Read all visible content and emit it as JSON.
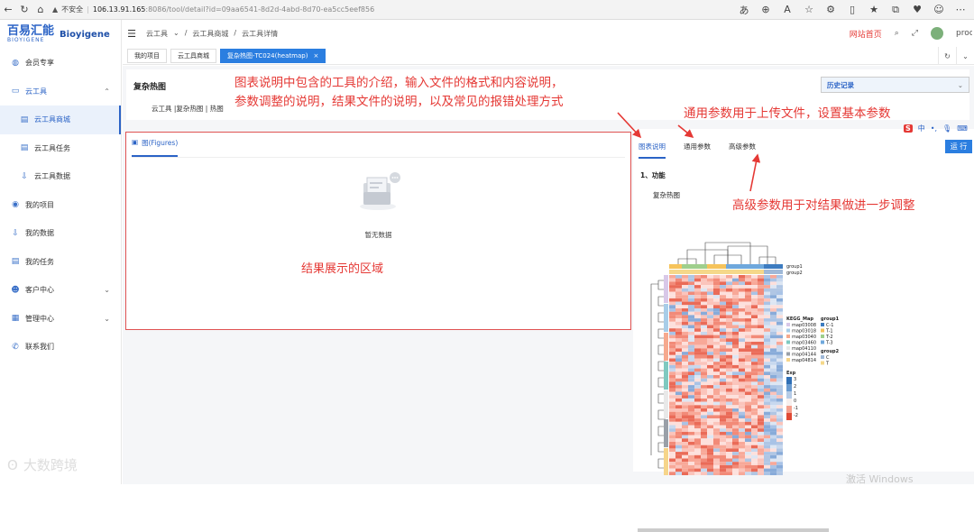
{
  "browser": {
    "warning_label": "不安全",
    "host": "106.13.91.165",
    "path": ":8086/tool/detail?id=09aa6541-8d2d-4abd-8d70-ea5cc5eef856"
  },
  "app": {
    "logo_cn": "百易汇能",
    "logo_en": "BIOYIGENE",
    "brand": "Bioyigene",
    "home_link": "网站首页",
    "user": "proc"
  },
  "breadcrumb": [
    "云工具",
    "云工具商城",
    "云工具详情"
  ],
  "sidebar": {
    "items": [
      {
        "label": "会员专享",
        "icon": "member-icon"
      },
      {
        "label": "云工具",
        "icon": "cloud-icon",
        "expanded": true
      },
      {
        "label": "云工具商城",
        "icon": "store-icon",
        "active": true
      },
      {
        "label": "云工具任务",
        "icon": "task-icon"
      },
      {
        "label": "云工具数据",
        "icon": "data-icon"
      },
      {
        "label": "我的项目",
        "icon": "project-icon"
      },
      {
        "label": "我的数据",
        "icon": "mydata-icon"
      },
      {
        "label": "我的任务",
        "icon": "mytask-icon"
      },
      {
        "label": "客户中心",
        "icon": "customer-icon"
      },
      {
        "label": "管理中心",
        "icon": "admin-icon"
      },
      {
        "label": "联系我们",
        "icon": "contact-icon"
      }
    ]
  },
  "tabs": [
    {
      "label": "我的项目"
    },
    {
      "label": "云工具商城"
    },
    {
      "label": "复杂热图-TC024(heatmap)",
      "active": true
    }
  ],
  "page": {
    "title": "复杂热图",
    "subpath": "云工具 |复杂热图 | 热图",
    "history_select": "历史记录"
  },
  "results": {
    "tab_label": "图(Figures)",
    "empty_text": "暂无数据",
    "area_label": "结果展示的区域"
  },
  "params": {
    "tabs": [
      "图表说明",
      "通用参数",
      "高级参数"
    ],
    "run_button": "运 行",
    "section_title": "1、功能",
    "figure_title": "复杂热图"
  },
  "heatmap": {
    "group_labels": [
      "group1",
      "group2"
    ],
    "kegg_title": "KEGG_Map",
    "kegg_items": [
      "map03008",
      "map03018",
      "map03040",
      "map03460",
      "map04110",
      "map04144",
      "map04814"
    ],
    "group1_title": "group1",
    "group1_items": [
      "C-1",
      "T-1",
      "T-2",
      "T-3"
    ],
    "group2_title": "group2",
    "group2_items": [
      "C",
      "T"
    ],
    "exp_title": "Exp",
    "exp_ticks": [
      "3",
      "2",
      "1",
      "0",
      "-1",
      "-2"
    ]
  },
  "annotations": {
    "intro": "图表说明中包含的工具的介绍，输入文件的格式和内容说明，参数调整的说明，结果文件的说明，以及常见的报错处理方式",
    "intro_line1": "图表说明中包含的工具的介绍，输入文件的格式和内容说明，",
    "intro_line2": "参数调整的说明，结果文件的说明，以及常见的报错处理方式",
    "general": "通用参数用于上传文件，设置基本参数",
    "advanced": "高级参数用于对结果做进一步调整"
  },
  "ime_bar": {
    "label": "中"
  },
  "watermark": "大数跨境",
  "windows_activation": "激活 Windows",
  "colors": {
    "accent": "#2b63c6",
    "annotation": "#e53935",
    "tab_active": "#2b7ee0"
  }
}
